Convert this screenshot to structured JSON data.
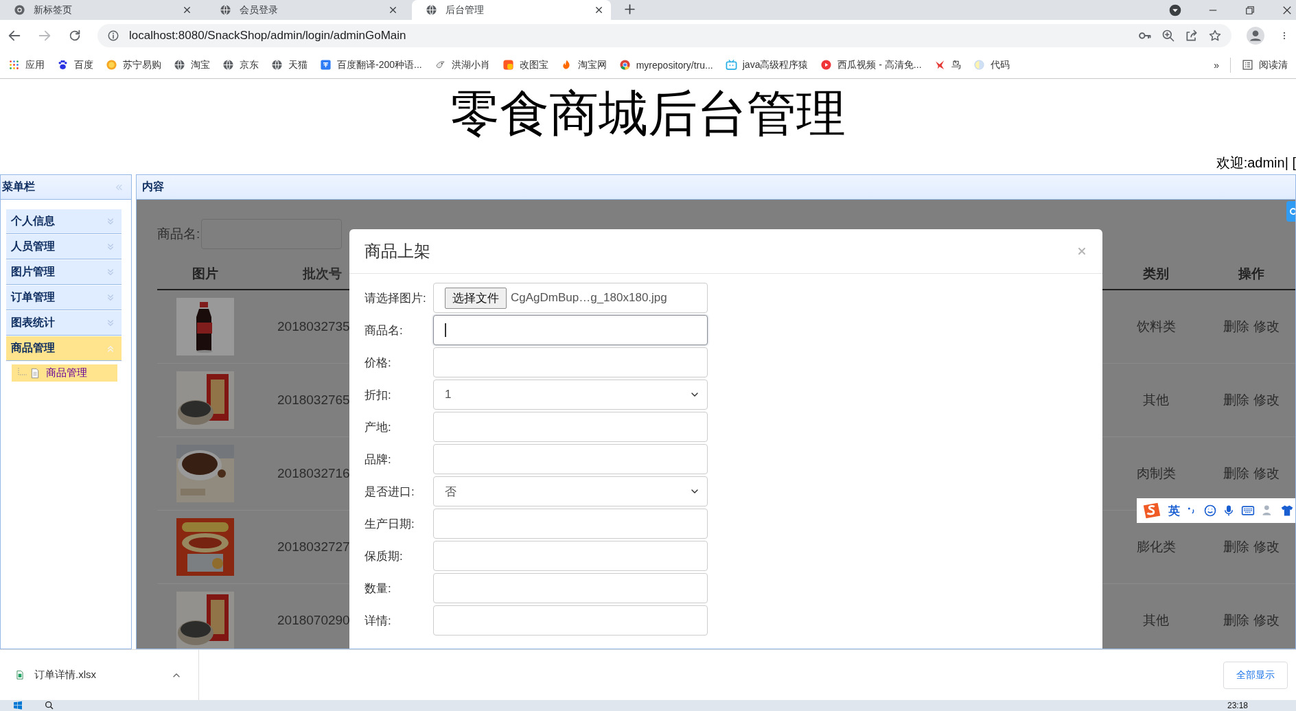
{
  "browser": {
    "tabs": [
      {
        "title": "新标签页",
        "selected": false
      },
      {
        "title": "会员登录",
        "selected": false
      },
      {
        "title": "后台管理",
        "selected": true
      }
    ],
    "url": "localhost:8080/SnackShop/admin/login/adminGoMain",
    "bookmarks": [
      {
        "label": "应用"
      },
      {
        "label": "百度"
      },
      {
        "label": "苏宁易购"
      },
      {
        "label": "淘宝"
      },
      {
        "label": "京东"
      },
      {
        "label": "天猫"
      },
      {
        "label": "百度翻译-200种语..."
      },
      {
        "label": "洪湖小肖"
      },
      {
        "label": "改图宝"
      },
      {
        "label": "淘宝网"
      },
      {
        "label": "myrepository/tru..."
      },
      {
        "label": "java高级程序猿"
      },
      {
        "label": "西瓜视频 - 高清免..."
      },
      {
        "label": "鸟"
      },
      {
        "label": "代码"
      }
    ],
    "more": "»",
    "reading_list": "阅读清"
  },
  "page": {
    "title": "零食商城后台管理",
    "welcome": "欢迎:admin| ["
  },
  "sidebar": {
    "title": "菜单栏",
    "items": [
      {
        "label": "个人信息",
        "expanded": false,
        "selected": false
      },
      {
        "label": "人员管理",
        "expanded": false,
        "selected": false
      },
      {
        "label": "图片管理",
        "expanded": false,
        "selected": false
      },
      {
        "label": "订单管理",
        "expanded": false,
        "selected": false
      },
      {
        "label": "图表统计",
        "expanded": false,
        "selected": false
      },
      {
        "label": "商品管理",
        "expanded": true,
        "selected": true,
        "children": [
          {
            "label": "商品管理",
            "selected": true
          }
        ]
      }
    ]
  },
  "content": {
    "title": "内容",
    "search_label": "商品名:",
    "table": {
      "columns": [
        "图片",
        "批次号",
        "类别",
        "操作"
      ],
      "rows": [
        {
          "picture": {
            "kind": "picture"
          },
          "batch": "2018032735",
          "category": "饮料类",
          "actions": [
            "删除",
            "修改"
          ]
        },
        {
          "picture": {
            "kind": "picture"
          },
          "batch": "2018032765",
          "category": "其他",
          "actions": [
            "删除",
            "修改"
          ]
        },
        {
          "picture": {
            "kind": "picture"
          },
          "batch": "2018032716",
          "category": "肉制类",
          "actions": [
            "删除",
            "修改"
          ]
        },
        {
          "picture": {
            "kind": "picture"
          },
          "batch": "2018032727",
          "category": "膨化类",
          "actions": [
            "删除",
            "修改"
          ]
        },
        {
          "picture": {
            "kind": "picture"
          },
          "batch": "2018070290",
          "category": "其他",
          "actions": [
            "删除",
            "修改"
          ]
        }
      ]
    }
  },
  "modal": {
    "title": "商品上架",
    "fields": [
      {
        "label": "请选择图片:",
        "kind": "file",
        "button": "选择文件",
        "value": "CgAgDmBup…g_180x180.jpg",
        "focused": false
      },
      {
        "label": "商品名:",
        "kind": "text",
        "focused": true
      },
      {
        "label": "价格:",
        "kind": "text",
        "focused": false
      },
      {
        "label": "折扣:",
        "kind": "select",
        "value": "1",
        "focused": false
      },
      {
        "label": "产地:",
        "kind": "text",
        "focused": false
      },
      {
        "label": "品牌:",
        "kind": "text",
        "focused": false
      },
      {
        "label": "是否进口:",
        "kind": "select",
        "value": "否",
        "focused": false
      },
      {
        "label": "生产日期:",
        "kind": "text",
        "focused": false
      },
      {
        "label": "保质期:",
        "kind": "text",
        "focused": false
      },
      {
        "label": "数量:",
        "kind": "text",
        "focused": false
      },
      {
        "label": "详情:",
        "kind": "text",
        "focused": false
      }
    ]
  },
  "ime": {
    "mode": "英"
  },
  "downloads": {
    "items": [
      {
        "name": "订单详情.xlsx"
      }
    ],
    "show_all": "全部显示"
  },
  "taskbar": {
    "time": "23:18"
  }
}
